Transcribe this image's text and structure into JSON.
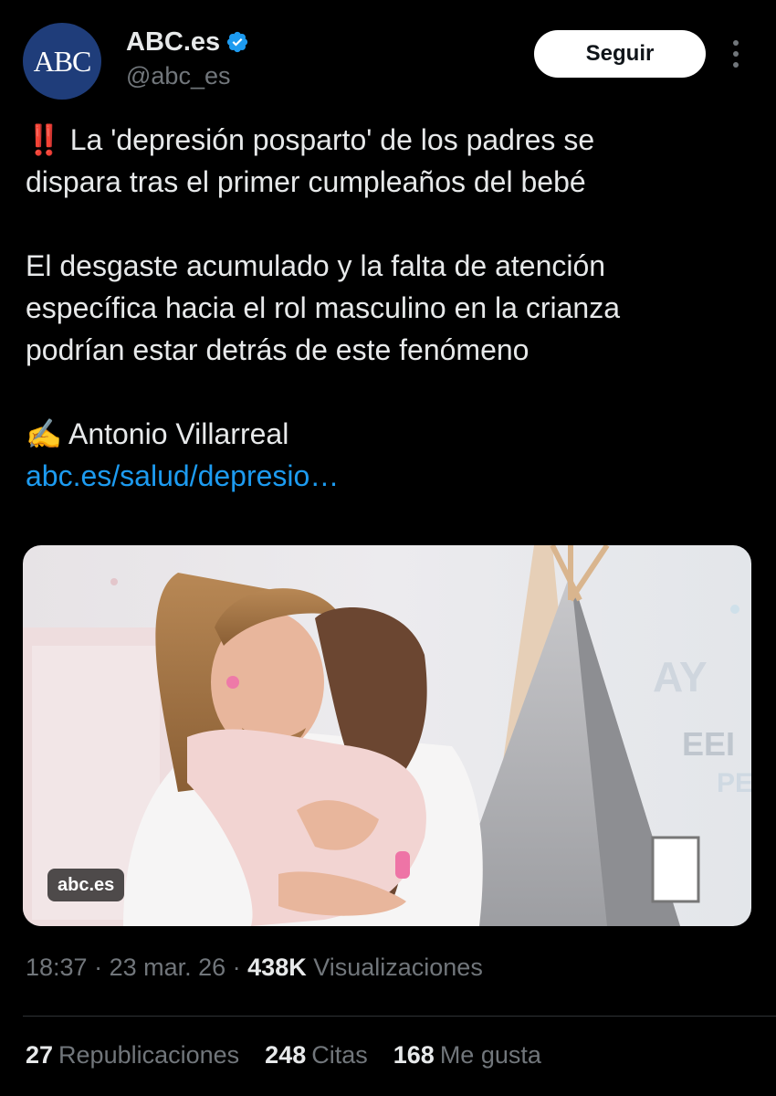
{
  "header": {
    "avatar_text": "ABC",
    "display_name": "ABC.es",
    "handle": "@abc_es",
    "follow_label": "Seguir"
  },
  "tweet": {
    "headline_line1": "‼️ La 'depresión posparto' de los padres se",
    "headline_line2": "dispara tras el primer cumpleaños del bebé",
    "body_line1": "El desgaste acumulado y la falta de atención",
    "body_line2": "específica hacia el rol masculino en la crianza",
    "body_line3": "podrían estar detrás de este fenómeno",
    "author_line": "✍️ Antonio Villarreal",
    "link": "abc.es/salud/depresio…"
  },
  "media": {
    "source_badge": "abc.es",
    "tent_letters": "AY",
    "tent_letters2": "EEI",
    "tent_letters3": "PE"
  },
  "meta": {
    "time": "18:37",
    "separator": " · ",
    "date": "23 mar. 26",
    "views_count": "438K",
    "views_label": " Visualizaciones"
  },
  "stats": {
    "reposts_count": "27",
    "reposts_label": "Republicaciones",
    "quotes_count": "248",
    "quotes_label": "Citas",
    "likes_count": "168",
    "likes_label": "Me gusta"
  },
  "colors": {
    "background": "#000000",
    "text": "#e7e9ea",
    "secondary": "#71767b",
    "link": "#1d9bf0",
    "verified": "#1d9bf0",
    "avatar": "#1f3d7a"
  },
  "icons": {
    "verified": "verified-badge-icon",
    "more": "more-options-icon"
  }
}
